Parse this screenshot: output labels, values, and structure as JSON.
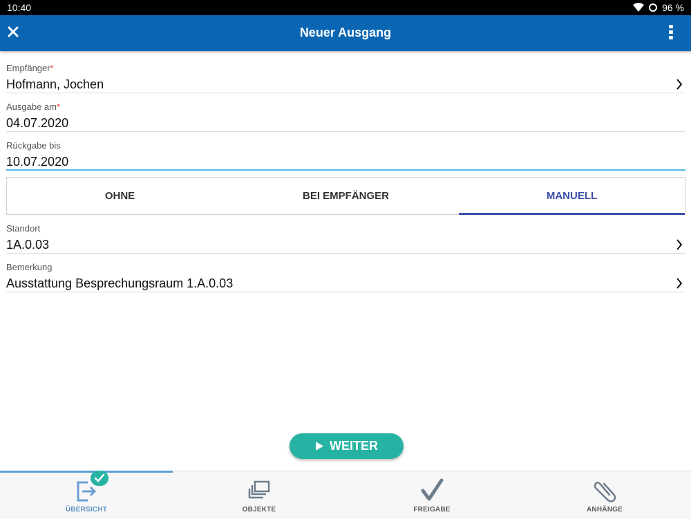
{
  "status_bar": {
    "time": "10:40",
    "battery": "96 %"
  },
  "appbar": {
    "title": "Neuer Ausgang"
  },
  "fields": {
    "empfaenger": {
      "label": "Empfänger",
      "required": "*",
      "value": "Hofmann, Jochen"
    },
    "ausgabe": {
      "label": "Ausgabe am",
      "required": "*",
      "value": "04.07.2020"
    },
    "rueckgabe": {
      "label": "Rückgabe bis",
      "value": "10.07.2020"
    },
    "standort": {
      "label": "Standort",
      "value": "1A.0.03"
    },
    "bemerkung": {
      "label": "Bemerkung",
      "value": "Ausstattung Besprechungsraum 1.A.0.03"
    }
  },
  "segment": {
    "options": [
      "OHNE",
      "BEI EMPFÄNGER",
      "MANUELL"
    ],
    "selected": "MANUELL"
  },
  "action_button": {
    "label": "WEITER"
  },
  "bottom_nav": {
    "items": [
      {
        "label": "ÜBERSICHT",
        "icon": "exit-check-icon",
        "active": true
      },
      {
        "label": "OBJEKTE",
        "icon": "stack-icon",
        "active": false
      },
      {
        "label": "FREIGABE",
        "icon": "checkmark-icon",
        "active": false
      },
      {
        "label": "ANHÄNGE",
        "icon": "paperclip-icon",
        "active": false
      }
    ]
  },
  "colors": {
    "appbar": "#0a66b3",
    "accent": "#27b3a3",
    "segment_active": "#3b4ea8",
    "focus_underline": "#4fb7e6",
    "required": "#e53935"
  }
}
